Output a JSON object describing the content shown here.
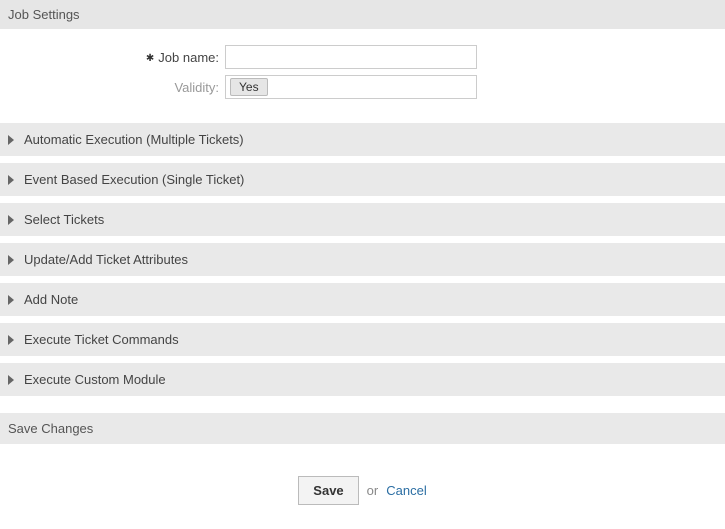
{
  "header": {
    "title": "Job Settings"
  },
  "form": {
    "jobName": {
      "label": "Job name:",
      "value": "",
      "required": true
    },
    "validity": {
      "label": "Validity:",
      "selected": "Yes"
    }
  },
  "accordion": [
    {
      "label": "Automatic Execution (Multiple Tickets)"
    },
    {
      "label": "Event Based Execution (Single Ticket)"
    },
    {
      "label": "Select Tickets"
    },
    {
      "label": "Update/Add Ticket Attributes"
    },
    {
      "label": "Add Note"
    },
    {
      "label": "Execute Ticket Commands"
    },
    {
      "label": "Execute Custom Module"
    }
  ],
  "saveSection": {
    "title": "Save Changes"
  },
  "actions": {
    "saveLabel": "Save",
    "orLabel": "or",
    "cancelLabel": "Cancel"
  }
}
